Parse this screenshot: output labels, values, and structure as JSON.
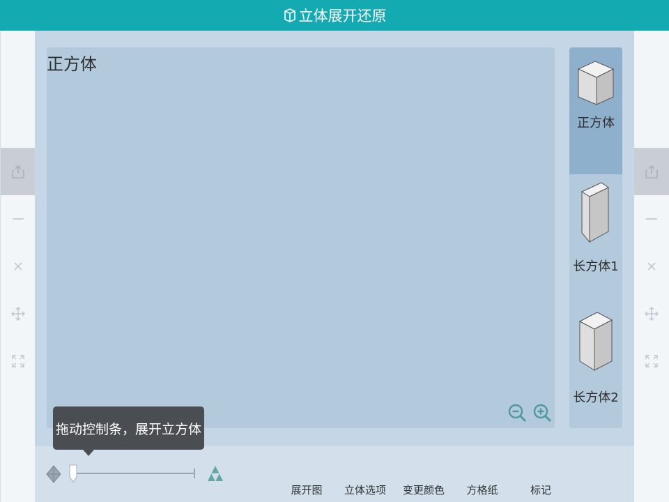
{
  "app": {
    "title": "立体展开还原"
  },
  "canvas": {
    "title": "正方体"
  },
  "tooltip": {
    "text": "拖动控制条，展开立方体"
  },
  "shapes": [
    {
      "label": "正方体",
      "icon": "cube-icon",
      "selected": true
    },
    {
      "label": "长方体1",
      "icon": "tall-cuboid-icon",
      "selected": false
    },
    {
      "label": "长方体2",
      "icon": "cuboid-icon",
      "selected": false
    }
  ],
  "toolbar": {
    "buttons": [
      {
        "label": "展开图"
      },
      {
        "label": "立体选项"
      },
      {
        "label": "变更颜色"
      },
      {
        "label": "方格纸"
      },
      {
        "label": "标记"
      }
    ]
  },
  "slider": {
    "value": 0
  },
  "side_icons": [
    "share-icon",
    "minimize-icon",
    "close-icon",
    "move-icon",
    "fullscreen-icon"
  ],
  "colors": {
    "titlebar": "#14aab2",
    "workspace": "#c5d7e6",
    "canvas": "#b3c9dc",
    "selected_shape": "#8fb0cd",
    "tooltip": "#4a4d52",
    "zoom_icon": "#4f9a98"
  }
}
